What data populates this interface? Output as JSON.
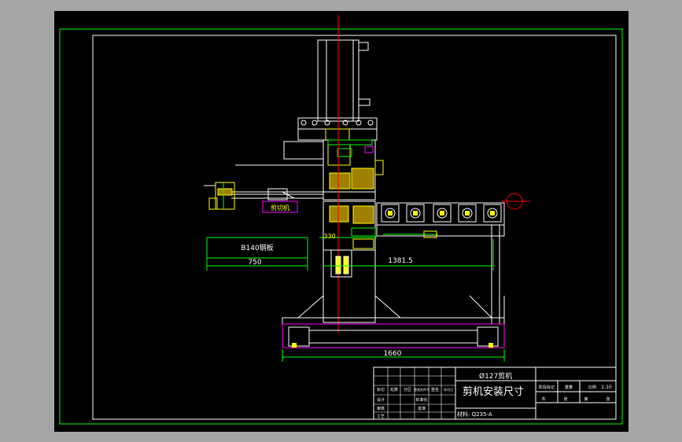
{
  "drawing": {
    "dimension_label": "B140钢板",
    "dims": {
      "d750": "750",
      "d1381": "1381.5",
      "d1660": "1660",
      "d330": "330"
    },
    "tag_label": "剪切机",
    "title_top": "Ø127剪机",
    "title_main": "剪机安装尺寸",
    "material": "材料: Q235-A",
    "scale": "1:10",
    "tb_left": [
      "标记",
      "处数",
      "分区",
      "更改文件号",
      "签名",
      "年月日",
      "设计",
      "审核",
      "工艺",
      "标准化",
      "批准"
    ],
    "tb_right": [
      "阶段标记",
      "重量",
      "比例",
      "共",
      "张",
      "第",
      "张"
    ]
  },
  "colors": {
    "background": "#000000",
    "frame": "#00ff00",
    "outline": "#ffffff",
    "centerline": "#ff0000",
    "detail": "#ffff00",
    "dimension": "#00ff00",
    "accent": "#ff00ff",
    "app_chrome": "#a5a5a5"
  }
}
